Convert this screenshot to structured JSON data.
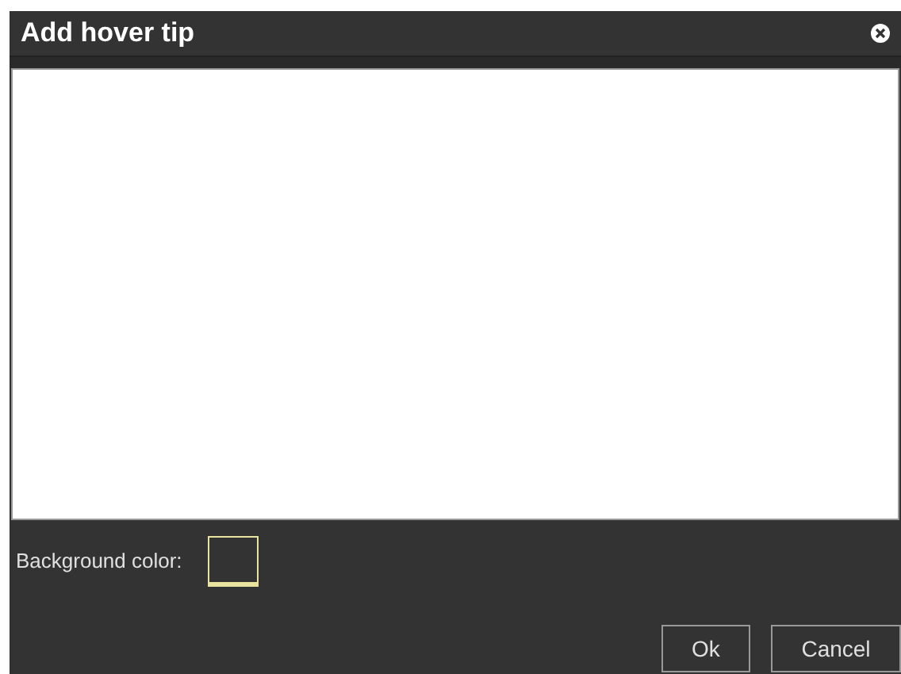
{
  "window": {
    "title": "Add hover tip"
  },
  "background_color": {
    "label": "Background color:"
  },
  "buttons": [
    "Ok",
    "Cancel"
  ]
}
